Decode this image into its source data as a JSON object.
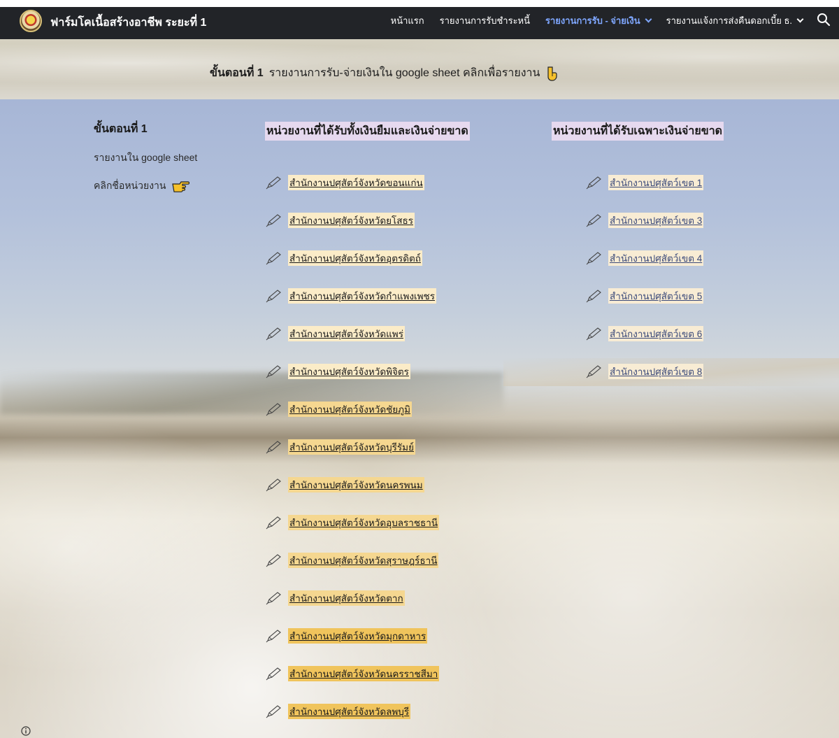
{
  "site": {
    "title": "ฟาร์มโคเนื้อสร้างอาชีพ ระยะที่ 1"
  },
  "nav": {
    "items": [
      {
        "label": "หน้าแรก"
      },
      {
        "label": "รายงานการรับชำระหนี้"
      },
      {
        "label": "รายงานการรับ - จ่ายเงิน"
      },
      {
        "label": "รายงานแจ้งการส่งคืนดอกเบี้ย ธ."
      }
    ],
    "active_color": "#7fa7ff"
  },
  "hero": {
    "step": "ขั้นตอนที่ 1",
    "text": "รายงานการรับ-จ่ายเงินใน google sheet  คลิกเพื่อรายงาน"
  },
  "left": {
    "step": "ขั้นตอนที่ 1",
    "sub": "รายงานใน google sheet",
    "click": "คลิกชื่อหน่วยงาน"
  },
  "columns": {
    "left_heading": "หน่วยงานที่ได้รับทั้งเงินยืมและเงินจ่ายขาด",
    "right_heading": "หน่วยงานที่ได้รับเฉพาะเงินจ่ายขาด"
  },
  "left_links": [
    "สำนักงานปศุสัตว์จังหวัดขอนแก่น",
    "สำนักงานปศุสัตว์จังหวัดยโสธร",
    "สำนักงานปศุสัตว์จังหวัดอุตรดิตถ์",
    "สำนักงานปศุสัตว์จังหวัดกำแพงเพชร",
    "สำนักงานปศุสัตว์จังหวัดแพร่",
    "สำนักงานปศุสัตว์จังหวัดพิจิตร",
    "สำนักงานปศุสัตว์จังหวัดชัยภูมิ",
    "สำนักงานปศุสัตว์จังหวัดบุรีรัมย์",
    "สำนักงานปศุสัตว์จังหวัดนครพนม",
    "สำนักงานปศุสัตว์จังหวัดอุบลราชธานี",
    "สำนักงานปศุสัตว์จังหวัดสุราษฎร์ธานี",
    "สำนักงานปศุสัตว์จังหวัดตาก",
    "สำนักงานปศุสัตว์จังหวัดมุกดาหาร",
    "สำนักงานปศุสัตว์จังหวัดนครราชสีมา",
    "สำนักงานปศุสัตว์จังหวัดลพบุรี"
  ],
  "right_links": [
    "สำนักงานปศุสัตว์เขต 1",
    "สำนักงานปศุสัตว์เขต 3",
    "สำนักงานปศุสัตว์เขต 4",
    "สำนักงานปศุสัตว์เขต 5",
    "สำนักงานปศุสัตว์เขต 6",
    "สำนักงานปศุสัตว์เขต 8"
  ],
  "icons": {
    "logo": "logo-emblem",
    "search": "search-icon",
    "pen": "pen-icon",
    "hand_down": "hand-point-down-icon",
    "hand_right": "hand-point-right-icon",
    "info": "info-icon"
  }
}
